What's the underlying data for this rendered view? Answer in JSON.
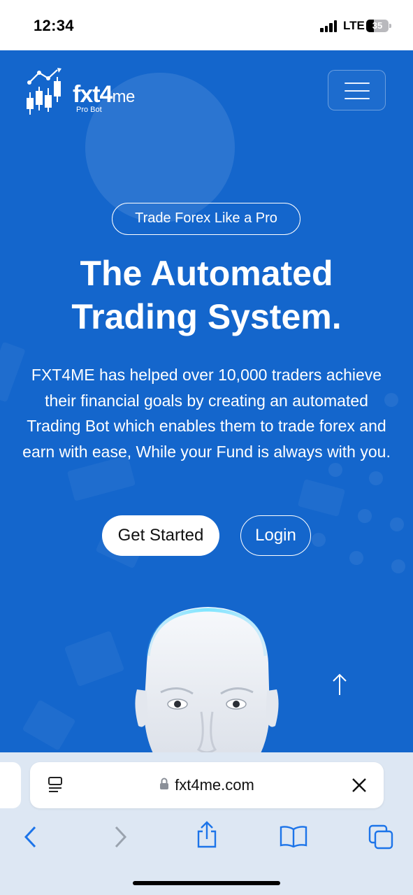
{
  "status_bar": {
    "time": "12:34",
    "network": "LTE",
    "battery": "35",
    "battery_level": 0.35
  },
  "header": {
    "logo_text": "fxt4me",
    "logo_main": "fxt4",
    "logo_suffix": "me",
    "logo_subtitle": "Pro Bot",
    "menu_icon": "hamburger-menu-icon"
  },
  "hero": {
    "badge": "Trade Forex Like a Pro",
    "headline_line1": "The Automated",
    "headline_line2": "Trading System.",
    "description": "FXT4ME has helped over 10,000 traders achieve their financial goals by creating an automated Trading Bot which enables them to trade forex and earn with ease, While your Fund is always with you.",
    "primary_button": "Get Started",
    "secondary_button": "Login",
    "scroll_icon": "arrow-up-icon"
  },
  "browser": {
    "url": "fxt4me.com",
    "reader_icon": "reader-mode-icon",
    "lock_icon": "lock-icon",
    "close_icon": "close-icon",
    "toolbar": [
      "back-icon",
      "forward-icon",
      "share-icon",
      "bookmarks-icon",
      "tabs-icon"
    ]
  },
  "colors": {
    "brand_blue": "#1466cc",
    "white": "#ffffff",
    "browser_bg": "#dde7f3",
    "ios_blue": "#1c74e9",
    "disabled_gray": "#9aa3ae"
  }
}
